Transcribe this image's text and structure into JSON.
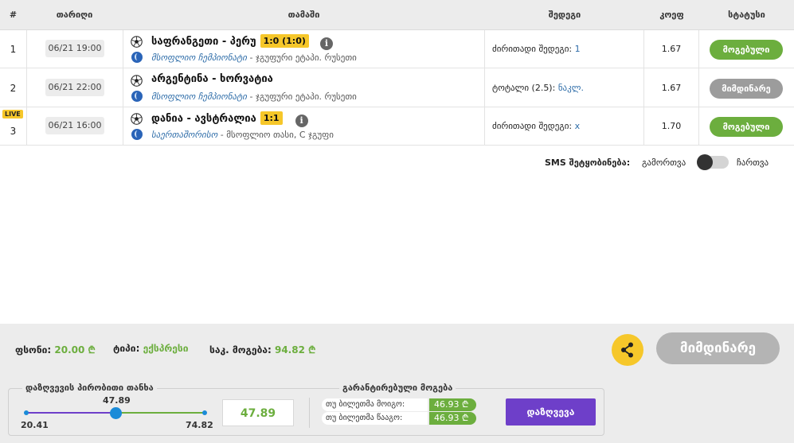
{
  "header": {
    "num": "#",
    "date": "თარიღი",
    "game": "თამაში",
    "result": "შედეგი",
    "coef": "კოეფ",
    "status": "სტატუსი"
  },
  "rows": [
    {
      "num": "1",
      "live": "",
      "date": "06/21 19:00",
      "teams": "საფრანგეთი - პერუ",
      "score": "1:0 (1:0)",
      "has_info": true,
      "league_link": "მსოფლიო ჩემპიონატი",
      "league_rest": " - ჯგუფური ეტაპი. რუსეთი",
      "result_label": "ძირითადი შედეგი: ",
      "result_value": "1",
      "coef": "1.67",
      "status": "მოგებული",
      "status_kind": "win"
    },
    {
      "num": "2",
      "live": "",
      "date": "06/21 22:00",
      "teams": "არგენტინა - ხორვატია",
      "score": "",
      "has_info": false,
      "league_link": "მსოფლიო ჩემპიონატი",
      "league_rest": " - ჯგუფური ეტაპი. რუსეთი",
      "result_label": "ტოტალი (2.5): ",
      "result_value": "ნაკლ.",
      "coef": "1.67",
      "status": "მიმდინარე",
      "status_kind": "running"
    },
    {
      "num": "3",
      "live": "LIVE",
      "date": "06/21 16:00",
      "teams": "დანია - ავსტრალია",
      "score": "1:1",
      "has_info": true,
      "league_link": "საერთაშორისო",
      "league_rest": " - მსოფლიო თასი, C ჯგუფი",
      "result_label": "ძირითადი შედეგი: ",
      "result_value": "x",
      "coef": "1.70",
      "status": "მოგებული",
      "status_kind": "win"
    }
  ],
  "sms": {
    "label": "SMS შეტყობინება:",
    "off": "გამორთვა",
    "on": "ჩართვა"
  },
  "summary": {
    "stake_label": "ფსონი:",
    "stake_value": "20.00 ₾",
    "type_label": "ტიპი:",
    "type_value": "ექსპრესი",
    "total_label": "საკ. მოგება:",
    "total_value": "94.82 ₾",
    "running_button": "მიმდინარე"
  },
  "buyout": {
    "legend": "დაზღვევის პირობითი თანხა",
    "min": "20.41",
    "max": "74.82",
    "current": "47.89",
    "current_fraction": 0.5,
    "value": "47.89",
    "guaranteed_legend": "გარანტირებული მოგება",
    "if_win_label": "თუ ბილეთმა მოიგო:",
    "if_win_value": "46.93 ₾",
    "if_lose_label": "თუ ბილეთმა წააგო:",
    "if_lose_value": "46.93 ₾",
    "button": "დაზღვევა"
  },
  "colors": {
    "win": "#6cae3e",
    "running": "#9c9c9c",
    "live": "#f6c72a",
    "buyout": "#6e3fc9",
    "slider": "#1a8bd8"
  }
}
